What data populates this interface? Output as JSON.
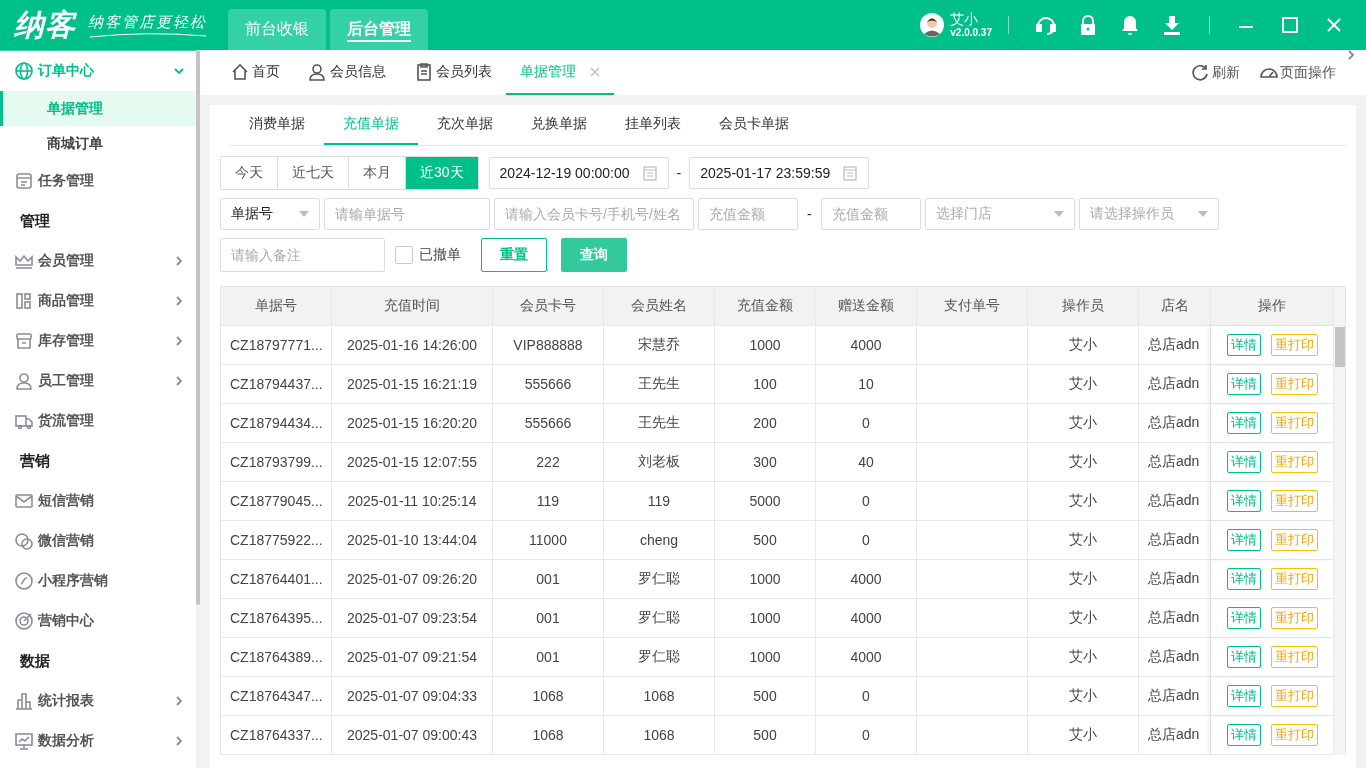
{
  "header": {
    "logo": "纳客",
    "slogan": "纳客管店更轻松",
    "modules": [
      {
        "label": "前台收银",
        "selected": false
      },
      {
        "label": "后台管理",
        "selected": true
      }
    ],
    "user": {
      "name": "艾小",
      "version": "v2.0.0.37"
    }
  },
  "sidebar": {
    "items": [
      {
        "kind": "folder",
        "label": "订单中心",
        "expanded": true,
        "children": [
          {
            "label": "单据管理",
            "selected": true
          },
          {
            "label": "商城订单",
            "selected": false
          }
        ]
      },
      {
        "kind": "link",
        "label": "任务管理"
      },
      {
        "kind": "section",
        "label": "管理"
      },
      {
        "kind": "folder",
        "label": "会员管理",
        "expanded": false
      },
      {
        "kind": "folder",
        "label": "商品管理",
        "expanded": false
      },
      {
        "kind": "folder",
        "label": "库存管理",
        "expanded": false
      },
      {
        "kind": "folder",
        "label": "员工管理",
        "expanded": false
      },
      {
        "kind": "link",
        "label": "货流管理"
      },
      {
        "kind": "section",
        "label": "营销"
      },
      {
        "kind": "link",
        "label": "短信营销"
      },
      {
        "kind": "link",
        "label": "微信营销"
      },
      {
        "kind": "link",
        "label": "小程序营销"
      },
      {
        "kind": "link",
        "label": "营销中心"
      },
      {
        "kind": "section",
        "label": "数据"
      },
      {
        "kind": "folder",
        "label": "统计报表",
        "expanded": false
      },
      {
        "kind": "folder",
        "label": "数据分析",
        "expanded": false
      }
    ]
  },
  "page_tabs": [
    {
      "label": "首页",
      "selected": false,
      "closable": false
    },
    {
      "label": "会员信息",
      "selected": false,
      "closable": false
    },
    {
      "label": "会员列表",
      "selected": false,
      "closable": false
    },
    {
      "label": "单据管理",
      "selected": true,
      "closable": true
    }
  ],
  "page_actions": [
    "刷新",
    "页面操作"
  ],
  "sub_tabs": [
    {
      "label": "消费单据",
      "selected": false
    },
    {
      "label": "充值单据",
      "selected": true
    },
    {
      "label": "充次单据",
      "selected": false
    },
    {
      "label": "兑换单据",
      "selected": false
    },
    {
      "label": "挂单列表",
      "selected": false
    },
    {
      "label": "会员卡单据",
      "selected": false
    }
  ],
  "quick_dates": [
    {
      "label": "今天",
      "selected": false
    },
    {
      "label": "近七天",
      "selected": false
    },
    {
      "label": "本月",
      "selected": false
    },
    {
      "label": "近30天",
      "selected": true
    }
  ],
  "date_range": {
    "start": "2024-12-19 00:00:00",
    "separator": "-",
    "end": "2025-01-17 23:59:59"
  },
  "filters": {
    "type_select": "单据号",
    "order_no": {
      "placeholder": "请输单据号"
    },
    "member": {
      "placeholder": "请输入会员卡号/手机号/姓名"
    },
    "amount_min": {
      "placeholder": "充值金额"
    },
    "amount_separator": "-",
    "amount_max": {
      "placeholder": "充值金额"
    },
    "store": {
      "placeholder": "选择门店"
    },
    "operator": {
      "placeholder": "请选择操作员"
    },
    "remark": {
      "placeholder": "请输入备注"
    },
    "revoked": {
      "label": "已撤单",
      "checked": false
    },
    "reset": "重置",
    "query": "查询"
  },
  "table": {
    "columns": [
      "单据号",
      "充值时间",
      "会员卡号",
      "会员姓名",
      "充值金额",
      "赠送金额",
      "支付单号",
      "操作员",
      "店名",
      "操作"
    ],
    "rows": [
      {
        "cells": [
          "CZ18797771...",
          "2025-01-16 14:26:00",
          "VIP888888",
          "宋慧乔",
          "1000",
          "4000",
          "",
          "艾小",
          "总店adn"
        ],
        "actions": [
          "详情",
          "重打印"
        ]
      },
      {
        "cells": [
          "CZ18794437...",
          "2025-01-15 16:21:19",
          "555666",
          "王先生",
          "100",
          "10",
          "",
          "艾小",
          "总店adn"
        ],
        "actions": [
          "详情",
          "重打印"
        ]
      },
      {
        "cells": [
          "CZ18794434...",
          "2025-01-15 16:20:20",
          "555666",
          "王先生",
          "200",
          "0",
          "",
          "艾小",
          "总店adn"
        ],
        "actions": [
          "详情",
          "重打印"
        ]
      },
      {
        "cells": [
          "CZ18793799...",
          "2025-01-15 12:07:55",
          "222",
          "刘老板",
          "300",
          "40",
          "",
          "艾小",
          "总店adn"
        ],
        "actions": [
          "详情",
          "重打印"
        ]
      },
      {
        "cells": [
          "CZ18779045...",
          "2025-01-11 10:25:14",
          "119",
          "119",
          "5000",
          "0",
          "",
          "艾小",
          "总店adn"
        ],
        "actions": [
          "详情",
          "重打印"
        ]
      },
      {
        "cells": [
          "CZ18775922...",
          "2025-01-10 13:44:04",
          "11000",
          "cheng",
          "500",
          "0",
          "",
          "艾小",
          "总店adn"
        ],
        "actions": [
          "详情",
          "重打印"
        ]
      },
      {
        "cells": [
          "CZ18764401...",
          "2025-01-07 09:26:20",
          "001",
          "罗仁聪",
          "1000",
          "4000",
          "",
          "艾小",
          "总店adn"
        ],
        "actions": [
          "详情",
          "重打印"
        ]
      },
      {
        "cells": [
          "CZ18764395...",
          "2025-01-07 09:23:54",
          "001",
          "罗仁聪",
          "1000",
          "4000",
          "",
          "艾小",
          "总店adn"
        ],
        "actions": [
          "详情",
          "重打印"
        ]
      },
      {
        "cells": [
          "CZ18764389...",
          "2025-01-07 09:21:54",
          "001",
          "罗仁聪",
          "1000",
          "4000",
          "",
          "艾小",
          "总店adn"
        ],
        "actions": [
          "详情",
          "重打印"
        ]
      },
      {
        "cells": [
          "CZ18764347...",
          "2025-01-07 09:04:33",
          "1068",
          "1068",
          "500",
          "0",
          "",
          "艾小",
          "总店adn"
        ],
        "actions": [
          "详情",
          "重打印"
        ]
      },
      {
        "cells": [
          "CZ18764337...",
          "2025-01-07 09:00:43",
          "1068",
          "1068",
          "500",
          "0",
          "",
          "艾小",
          "总店adn"
        ],
        "actions": [
          "详情",
          "重打印"
        ]
      }
    ]
  }
}
